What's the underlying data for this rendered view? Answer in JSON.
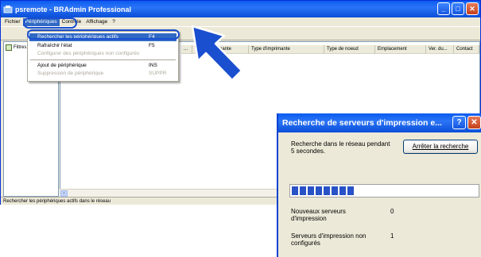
{
  "window": {
    "title": "psremote - BRAdmin Professional"
  },
  "menubar": {
    "items": [
      "Fichier",
      "Périphériques",
      "Contrôle",
      "Affichage",
      "?"
    ]
  },
  "tree": {
    "root_label": "Filtres"
  },
  "columns": [
    "...",
    "Et...",
    "Imprimante",
    "Type d'imprimante",
    "Type de noeud",
    "Emplacement",
    "Ver. du...",
    "Contact"
  ],
  "dropdown": {
    "items": [
      {
        "label": "Rechercher les périphériques actifs",
        "shortcut": "F4"
      },
      {
        "label": "Rafraîchir l'état",
        "shortcut": "F5"
      },
      {
        "label": "Configurer des périphériques non configurés",
        "shortcut": ""
      },
      {
        "label": "Ajout de périphérique",
        "shortcut": "INS"
      },
      {
        "label": "Suppression de périphérique",
        "shortcut": "SUPPR"
      }
    ]
  },
  "statusbar": {
    "text": "Rechercher les périphériques actifs dans le réseau"
  },
  "dialog": {
    "title": "Recherche de serveurs d'impression e...",
    "message": "Recherche dans le réseau pendant 5 secondes.",
    "stop_button": "Arrêter la recherche",
    "progress_blocks": 8,
    "stats": [
      {
        "label": "Nouveaux serveurs d'impression",
        "value": "0"
      },
      {
        "label": "Serveurs d'impression non configurés",
        "value": "1"
      }
    ]
  },
  "colors": {
    "title_blue": "#0a5cf0",
    "highlight": "#316ac5",
    "callout": "#1a4fcf",
    "progress": "#2952c6"
  }
}
